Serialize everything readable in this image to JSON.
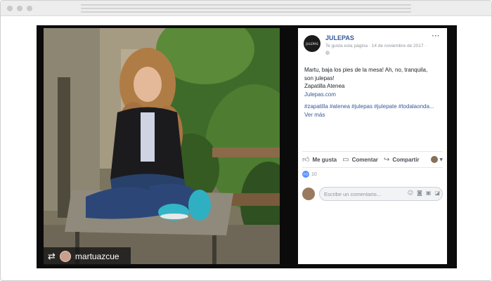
{
  "post": {
    "page_name": "JULEPAS",
    "page_logo_text": "JULEPAS",
    "meta": "Te gusta esta página · 14 de noviembre de 2017 ·",
    "globe_icon": "globe-icon",
    "more_icon": "more-options-icon",
    "text_line1": "Martu, baja los pies de la mesa! Ah, no, tranquila,",
    "text_line2": "son julepas!",
    "text_line3": "Zapatilla Atenea",
    "link": "Julepas.com",
    "hashtags": "#zapatilla #atenea #julepas #julepate #todalaonda...",
    "see_more": "Ver más",
    "actions": {
      "like": "Me gusta",
      "comment": "Comentar",
      "share": "Compartir"
    },
    "like_count": "10",
    "comment_placeholder": "Escribe un comentario..."
  },
  "repost": {
    "username": "martuazcue"
  },
  "colors": {
    "fb_blue": "#385898",
    "like_blue": "#5890ff",
    "text": "#1d2129",
    "muted": "#90949c"
  }
}
